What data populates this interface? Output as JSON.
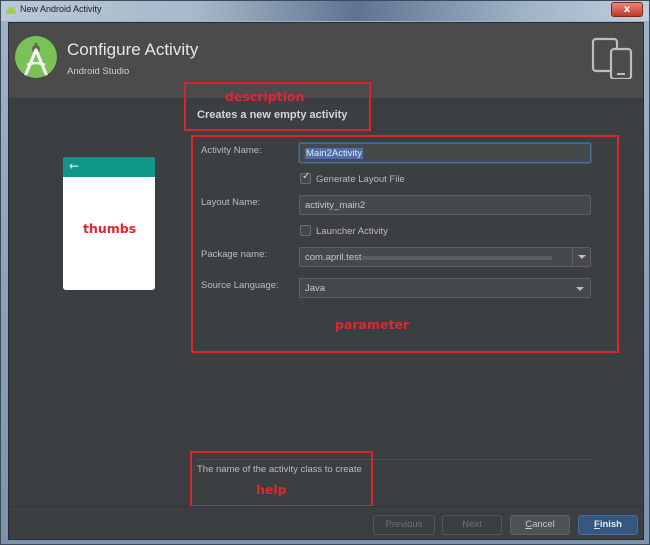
{
  "window": {
    "title": "New Android Activity",
    "close_label": "x"
  },
  "header": {
    "title": "Configure Activity",
    "subtitle": "Android Studio"
  },
  "description": {
    "annotation": "description",
    "text": "Creates a new empty activity"
  },
  "thumbnail": {
    "annotation": "thumbs",
    "back_glyph": "←",
    "appbar_color": "#0e9688"
  },
  "form": {
    "annotation": "parameter",
    "activity_name": {
      "label": "Activity Name:",
      "value": "Main2Activity",
      "selected": true
    },
    "generate_layout": {
      "label": "Generate Layout File",
      "checked": true
    },
    "layout_name": {
      "label": "Layout Name:",
      "value": "activity_main2"
    },
    "launcher_activity": {
      "label": "Launcher Activity",
      "checked": false
    },
    "package_name": {
      "label": "Package name:",
      "value": "com.april.test"
    },
    "source_language": {
      "label": "Source Language:",
      "value": "Java"
    }
  },
  "help": {
    "annotation": "help",
    "text": "The name of the activity class to create"
  },
  "buttons": {
    "previous": "Previous",
    "next": "Next",
    "cancel_mnemonic": "C",
    "cancel_rest": "ancel",
    "finish_mnemonic": "F",
    "finish_rest": "inish"
  },
  "colors": {
    "annotation_red": "#d9252e",
    "primary_button": "#365880",
    "android_green": "#78c257"
  }
}
